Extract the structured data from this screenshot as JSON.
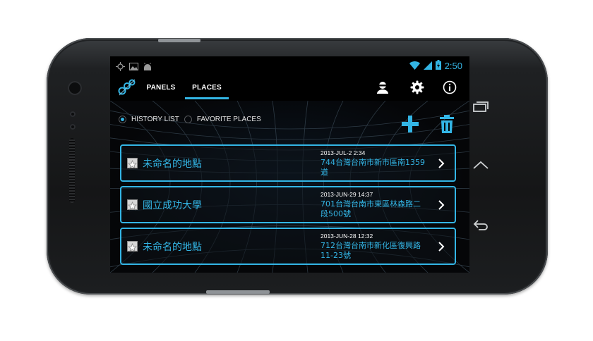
{
  "colors": {
    "accent": "#33b5e5",
    "text_white": "#ffffff",
    "screen_bg": "#000000",
    "phone_body": "#1a1b1c"
  },
  "statusbar": {
    "time": "2:50",
    "left_icons": [
      "gps-icon",
      "image-icon",
      "android-icon"
    ],
    "right_icons": [
      "wifi-icon",
      "signal-icon",
      "battery-charging-icon"
    ]
  },
  "actionbar": {
    "logo_icon": "app-logo-icon",
    "tabs": [
      {
        "label": "PANELS",
        "active": false
      },
      {
        "label": "PLACES",
        "active": true
      }
    ],
    "actions": [
      "user-icon",
      "gear-icon",
      "info-icon"
    ]
  },
  "filter": {
    "history_label": "HISTORY LIST",
    "favorite_label": "FAVORITE PLACES",
    "selected": "history"
  },
  "toolbar": {
    "add_icon": "plus-icon",
    "delete_icon": "trash-icon"
  },
  "places": [
    {
      "name": "未命名的地點",
      "date": "2013-JUL-2 2:34",
      "address": "744台灣台南市新市區南1359道"
    },
    {
      "name": "國立成功大學",
      "date": "2013-JUN-29 14:37",
      "address": "701台灣台南市東區林森路二段500號"
    },
    {
      "name": "未命名的地點",
      "date": "2013-JUN-28 12:32",
      "address": "712台灣台南市新化區復興路11-23號"
    }
  ],
  "hardware_keys": [
    "recent-apps-icon",
    "home-icon",
    "back-icon"
  ]
}
